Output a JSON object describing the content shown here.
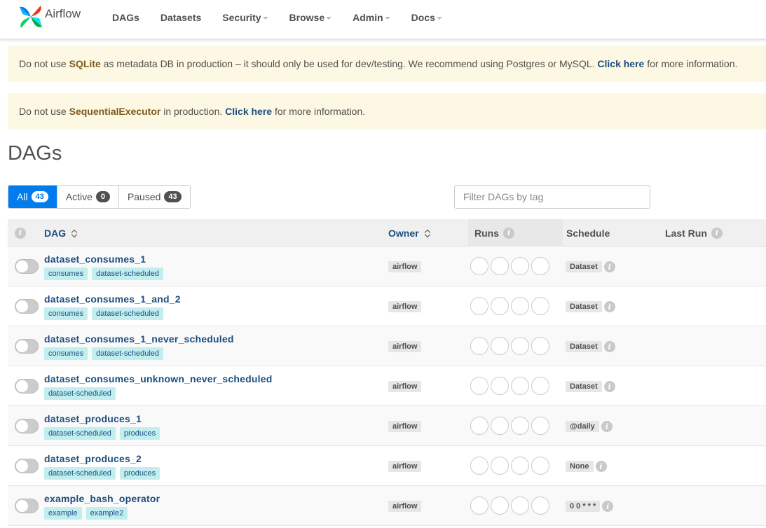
{
  "brand": {
    "name": "Airflow"
  },
  "nav": [
    {
      "label": "DAGs",
      "dropdown": false
    },
    {
      "label": "Datasets",
      "dropdown": false
    },
    {
      "label": "Security",
      "dropdown": true
    },
    {
      "label": "Browse",
      "dropdown": true
    },
    {
      "label": "Admin",
      "dropdown": true
    },
    {
      "label": "Docs",
      "dropdown": true
    }
  ],
  "alerts": {
    "sqlite": {
      "pre": "Do not use ",
      "hl": "SQLite",
      "mid": " as metadata DB in production – it should only be used for dev/testing. We recommend using Postgres or MySQL. ",
      "link": "Click here",
      "post": " for more information."
    },
    "executor": {
      "pre": "Do not use ",
      "hl": "SequentialExecutor",
      "mid": " in production. ",
      "link": "Click here",
      "post": " for more information."
    }
  },
  "page_title": "DAGs",
  "filters": [
    {
      "label": "All",
      "count": "43",
      "active": true
    },
    {
      "label": "Active",
      "count": "0",
      "active": false
    },
    {
      "label": "Paused",
      "count": "43",
      "active": false
    }
  ],
  "tag_filter": {
    "placeholder": "Filter DAGs by tag"
  },
  "columns": {
    "info": "i",
    "dag": "DAG",
    "owner": "Owner",
    "runs": "Runs",
    "schedule": "Schedule",
    "last_run": "Last Run"
  },
  "rows": [
    {
      "name": "dataset_consumes_1",
      "tags": [
        "consumes",
        "dataset-scheduled"
      ],
      "owner": "airflow",
      "schedule": "Dataset"
    },
    {
      "name": "dataset_consumes_1_and_2",
      "tags": [
        "consumes",
        "dataset-scheduled"
      ],
      "owner": "airflow",
      "schedule": "Dataset"
    },
    {
      "name": "dataset_consumes_1_never_scheduled",
      "tags": [
        "consumes",
        "dataset-scheduled"
      ],
      "owner": "airflow",
      "schedule": "Dataset"
    },
    {
      "name": "dataset_consumes_unknown_never_scheduled",
      "tags": [
        "dataset-scheduled"
      ],
      "owner": "airflow",
      "schedule": "Dataset"
    },
    {
      "name": "dataset_produces_1",
      "tags": [
        "dataset-scheduled",
        "produces"
      ],
      "owner": "airflow",
      "schedule": "@daily"
    },
    {
      "name": "dataset_produces_2",
      "tags": [
        "dataset-scheduled",
        "produces"
      ],
      "owner": "airflow",
      "schedule": "None"
    },
    {
      "name": "example_bash_operator",
      "tags": [
        "example",
        "example2"
      ],
      "owner": "airflow",
      "schedule": "0 0 * * *"
    }
  ],
  "colors": {
    "primary": "#017cee",
    "link": "#1c4e80",
    "alert_bg": "#fcf8e3",
    "tag_bg": "#c2eef0"
  }
}
